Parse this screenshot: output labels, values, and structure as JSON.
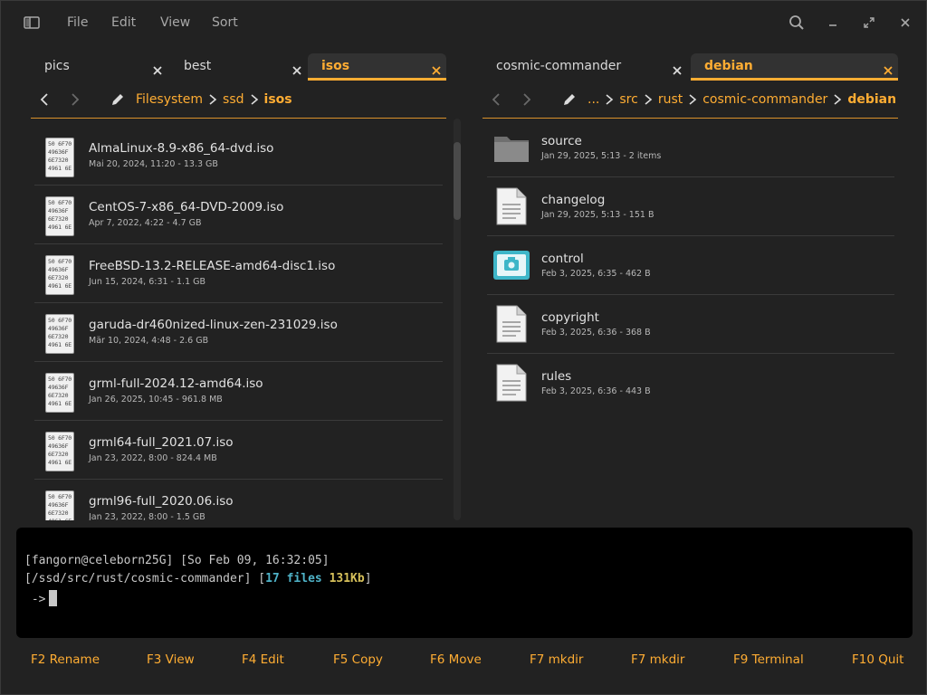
{
  "header": {
    "menu": [
      "File",
      "Edit",
      "View",
      "Sort"
    ]
  },
  "left_pane": {
    "tabs": [
      {
        "label": "pics"
      },
      {
        "label": "best"
      },
      {
        "label": "isos"
      }
    ],
    "breadcrumbs": [
      "Filesystem",
      "ssd",
      "isos"
    ],
    "files": [
      {
        "name": "AlmaLinux-8.9-x86_64-dvd.iso",
        "meta": "Mai 20, 2024, 11:20  - 13.3 GB"
      },
      {
        "name": "CentOS-7-x86_64-DVD-2009.iso",
        "meta": "Apr 7, 2022, 4:22  - 4.7 GB"
      },
      {
        "name": "FreeBSD-13.2-RELEASE-amd64-disc1.iso",
        "meta": "Jun 15, 2024, 6:31  - 1.1 GB"
      },
      {
        "name": "garuda-dr460nized-linux-zen-231029.iso",
        "meta": "Mär 10, 2024, 4:48  - 2.6 GB"
      },
      {
        "name": "grml-full-2024.12-amd64.iso",
        "meta": "Jan 26, 2025, 10:45  - 961.8 MB"
      },
      {
        "name": "grml64-full_2021.07.iso",
        "meta": "Jan 23, 2022, 8:00  - 824.4 MB"
      },
      {
        "name": "grml96-full_2020.06.iso",
        "meta": "Jan 23, 2022, 8:00  - 1.5 GB"
      }
    ],
    "iso_icon_text": [
      "50 6F70",
      "49636F",
      "6E7320",
      "4961 6E"
    ]
  },
  "right_pane": {
    "tabs": [
      {
        "label": "cosmic-commander"
      },
      {
        "label": "debian"
      }
    ],
    "breadcrumbs": [
      "...",
      "src",
      "rust",
      "cosmic-commander",
      "debian"
    ],
    "files": [
      {
        "name": "source",
        "meta": "Jan 29, 2025, 5:13  - 2 items",
        "icon": "folder-icon"
      },
      {
        "name": "changelog",
        "meta": "Jan 29, 2025, 5:13  - 151 B",
        "icon": "text-file-icon"
      },
      {
        "name": "control",
        "meta": "Feb 3, 2025, 6:35  - 462 B",
        "icon": "image-file-icon"
      },
      {
        "name": "copyright",
        "meta": "Feb 3, 2025, 6:36  - 368 B",
        "icon": "text-file-icon"
      },
      {
        "name": "rules",
        "meta": "Feb 3, 2025, 6:36  - 443 B",
        "icon": "text-file-icon"
      }
    ]
  },
  "terminal": {
    "line1": "[fangorn@celeborn25G] [So Feb 09, 16:32:05]",
    "line2_prefix": "[/ssd/src/rust/cosmic-commander] [",
    "line2_files": "17 files",
    "line2_size": "131Kb",
    "line2_suffix": "]",
    "prompt": " ->"
  },
  "fkeys": [
    "F2 Rename",
    "F3 View",
    "F4 Edit",
    "F5 Copy",
    "F6 Move",
    "F7 mkdir",
    "F7 mkdir",
    "F9 Terminal",
    "F10 Quit"
  ],
  "colors": {
    "accent": "#ffad33",
    "background": "#222222",
    "terminal_bg": "#000000"
  }
}
